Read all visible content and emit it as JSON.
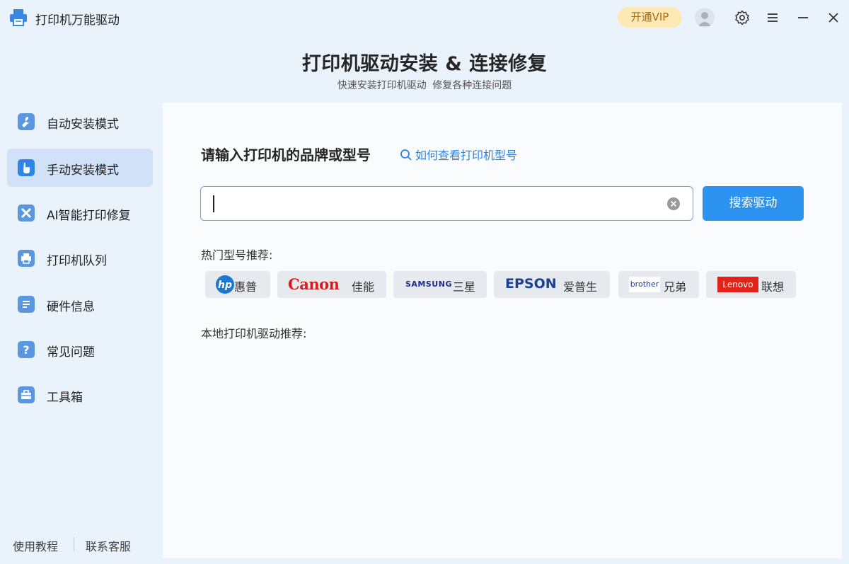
{
  "app": {
    "title": "打印机万能驱动"
  },
  "titlebar": {
    "vip_label": "开通VIP"
  },
  "header": {
    "title": "打印机驱动安装 & 连接修复",
    "subtitle": "快速安装打印机驱动 修复各种连接问题"
  },
  "sidebar": {
    "items": [
      {
        "label": "自动安装模式",
        "icon": "wrench-icon"
      },
      {
        "label": "手动安装模式",
        "icon": "hand-pointer-icon"
      },
      {
        "label": "AI智能打印修复",
        "icon": "tools-icon"
      },
      {
        "label": "打印机队列",
        "icon": "printer-icon"
      },
      {
        "label": "硬件信息",
        "icon": "list-icon"
      },
      {
        "label": "常见问题",
        "icon": "question-icon"
      },
      {
        "label": "工具箱",
        "icon": "toolbox-icon"
      }
    ],
    "active_index": 1,
    "footer": {
      "tutorial": "使用教程",
      "support": "联系客服"
    }
  },
  "main": {
    "search_title": "请输入打印机的品牌或型号",
    "help_link": "如何查看打印机型号",
    "search": {
      "value": "",
      "button": "搜索驱动"
    },
    "hot_label": "热门型号推荐:",
    "brands": [
      {
        "logo": "hp",
        "name": "惠普"
      },
      {
        "logo": "Canon",
        "name": "佳能"
      },
      {
        "logo": "SAMSUNG",
        "name": "三星"
      },
      {
        "logo": "EPSON",
        "name": "爱普生"
      },
      {
        "logo": "brother",
        "name": "兄弟"
      },
      {
        "logo": "Lenovo",
        "name": "联想"
      }
    ],
    "local_label": "本地打印机驱动推荐:"
  },
  "colors": {
    "accent": "#2d93f1",
    "vip_bg": "#fde9b5",
    "vip_text": "#a86a12",
    "sidebar_active": "#d1e1f7"
  }
}
